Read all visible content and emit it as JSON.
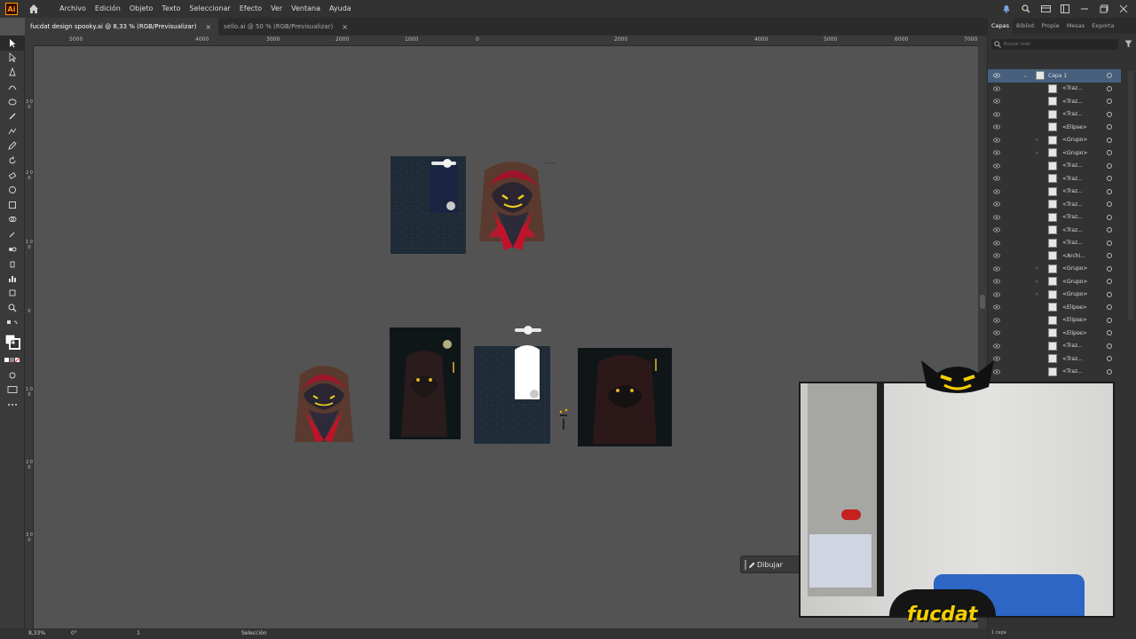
{
  "menubar": {
    "app_logo": "Ai",
    "items": [
      "Archivo",
      "Edición",
      "Objeto",
      "Texto",
      "Seleccionar",
      "Efecto",
      "Ver",
      "Ventana",
      "Ayuda"
    ]
  },
  "tabs": [
    {
      "label": "fucdat design spooky.ai @ 8,33 % (RGB/Previsualizar)",
      "close": "×",
      "active": true
    },
    {
      "label": "sello.ai @ 50 % (RGB/Previsualizar)",
      "close": "×",
      "active": false
    }
  ],
  "ruler_h": [
    "5000",
    "4000",
    "3000",
    "2000",
    "1000",
    "0",
    "2000",
    "4000",
    "5000",
    "6000",
    "7000"
  ],
  "ruler_v": [
    "3 0 0",
    "2 0 0",
    "1 0 0",
    "0",
    "1 0 0",
    "2 0 0",
    "3 0 0"
  ],
  "panel": {
    "tabs": [
      "Capas",
      "Bibliot",
      "Propie",
      "Mesas",
      "Exporta"
    ],
    "search_placeholder": "Buscar todo",
    "top_layer": "Capa 1",
    "layers": [
      {
        "name": "<Traz...",
        "expand": false
      },
      {
        "name": "<Traz...",
        "expand": false
      },
      {
        "name": "<Traz...",
        "expand": false
      },
      {
        "name": "<Elipse>",
        "expand": false
      },
      {
        "name": "<Grupo>",
        "expand": true
      },
      {
        "name": "<Grupo>",
        "expand": true
      },
      {
        "name": "<Traz...",
        "expand": false
      },
      {
        "name": "<Traz...",
        "expand": false
      },
      {
        "name": "<Traz...",
        "expand": false
      },
      {
        "name": "<Traz...",
        "expand": false
      },
      {
        "name": "<Traz...",
        "expand": false
      },
      {
        "name": "<Traz...",
        "expand": false
      },
      {
        "name": "<Traz...",
        "expand": false
      },
      {
        "name": "<Archi...",
        "expand": false
      },
      {
        "name": "<Grupo>",
        "expand": true
      },
      {
        "name": "<Grupo>",
        "expand": true
      },
      {
        "name": "<Grupo>",
        "expand": true
      },
      {
        "name": "<Elipse>",
        "expand": false
      },
      {
        "name": "<Elipse>",
        "expand": false
      },
      {
        "name": "<Elipse>",
        "expand": false
      },
      {
        "name": "<Traz...",
        "expand": false
      },
      {
        "name": "<Traz...",
        "expand": false
      },
      {
        "name": "<Traz...",
        "expand": false
      }
    ],
    "footer": "1 capa"
  },
  "status": {
    "zoom": "8,33%",
    "rotation": "0°",
    "artboard": "1",
    "tool": "Selección"
  },
  "dibujar_label": "Dibujar",
  "brand": "fucdat",
  "colors": {
    "ui_dark": "#323232",
    "canvas": "#535353",
    "accent_red": "#c0132a",
    "cat_yellow": "#f2d21b",
    "wall_navy": "#1f2c3a"
  }
}
